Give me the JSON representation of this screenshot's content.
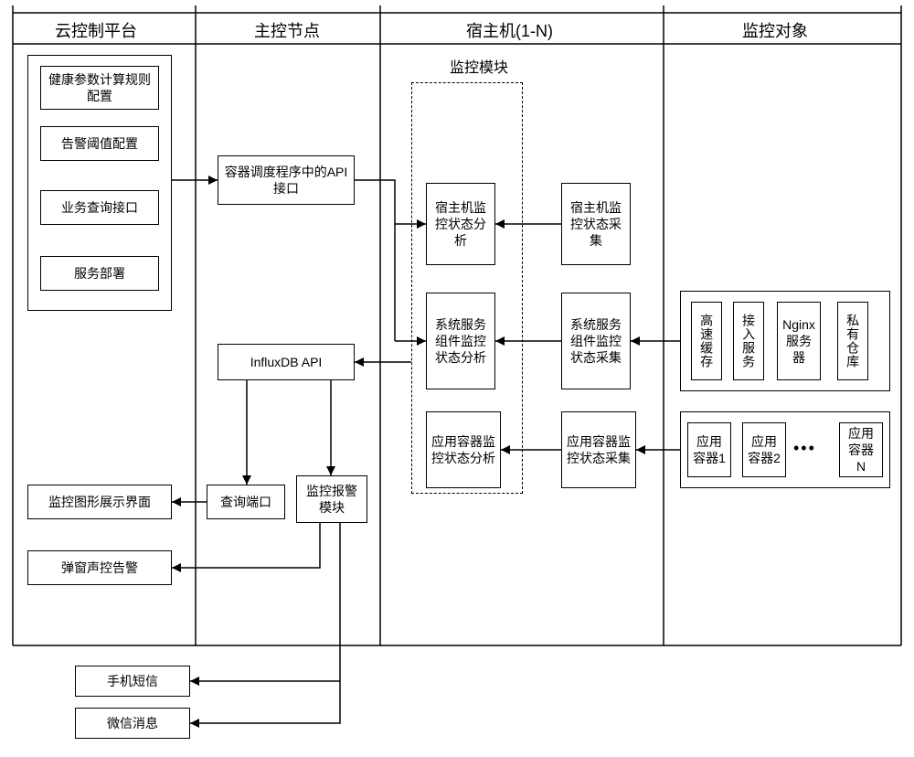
{
  "columns": {
    "cloud_platform": "云控制平台",
    "master_node": "主控节点",
    "host_machine": "宿主机(1-N)",
    "monitored_object": "监控对象"
  },
  "monitor_module_title": "监控模块",
  "cloud": {
    "health_config": "健康参数计算规则配置",
    "alarm_threshold": "告警阈值配置",
    "biz_query_interface": "业务查询接口",
    "service_deploy": "服务部署",
    "monitor_graph_ui": "监控图形展示界面",
    "popup_audio_alarm": "弹窗声控告警"
  },
  "master": {
    "container_api": "容器调度程序中的API接口",
    "influxdb_api": "InfluxDB API",
    "query_port": "查询端口",
    "monitor_alarm_module": "监控报警模块"
  },
  "host": {
    "analysis": {
      "host_status": "宿主机监控状态分析",
      "sys_service": "系统服务组件监控状态分析",
      "app_container": "应用容器监控状态分析"
    },
    "collect": {
      "host_status": "宿主机监控状态采集",
      "sys_service": "系统服务组件监控状态采集",
      "app_container": "应用容器监控状态采集"
    }
  },
  "objects": {
    "high_speed_cache": "高速缓存",
    "access_service": "接入服务",
    "nginx_server": "Nginx服务器",
    "private_repo": "私有仓库",
    "app_container_1": "应用容器1",
    "app_container_2": "应用容器2",
    "app_container_n": "应用容器N",
    "ellipsis": "•••"
  },
  "external": {
    "sms": "手机短信",
    "wechat": "微信消息"
  }
}
